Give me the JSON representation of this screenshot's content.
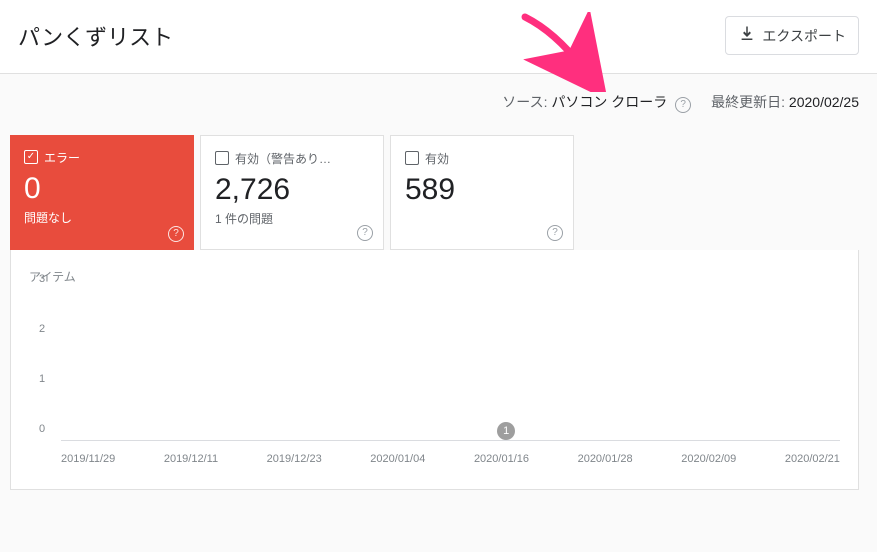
{
  "header": {
    "title": "パンくずリスト",
    "export_label": "エクスポート"
  },
  "meta": {
    "source_label": "ソース:",
    "source_value": "パソコン クローラ",
    "updated_label": "最終更新日:",
    "updated_value": "2020/02/25"
  },
  "cards": [
    {
      "label": "エラー",
      "value": "0",
      "sub": "問題なし",
      "active": true
    },
    {
      "label": "有効（警告あり…",
      "value": "2,726",
      "sub": "1 件の問題",
      "active": false
    },
    {
      "label": "有効",
      "value": "589",
      "sub": "",
      "active": false
    }
  ],
  "chart_data": {
    "type": "line",
    "title": "アイテム",
    "ylabel": "",
    "xlabel": "",
    "ylim": [
      0,
      3
    ],
    "y_ticks": [
      0,
      1,
      2,
      3
    ],
    "categories": [
      "2019/11/29",
      "2019/12/11",
      "2019/12/23",
      "2020/01/04",
      "2020/01/16",
      "2020/01/28",
      "2020/02/09",
      "2020/02/21"
    ],
    "series": [
      {
        "name": "エラー",
        "values": [
          0,
          0,
          0,
          0,
          0,
          0,
          0,
          0
        ]
      }
    ],
    "annotations": [
      {
        "x": "2020/01/16",
        "y": 0,
        "label": "1"
      }
    ]
  }
}
